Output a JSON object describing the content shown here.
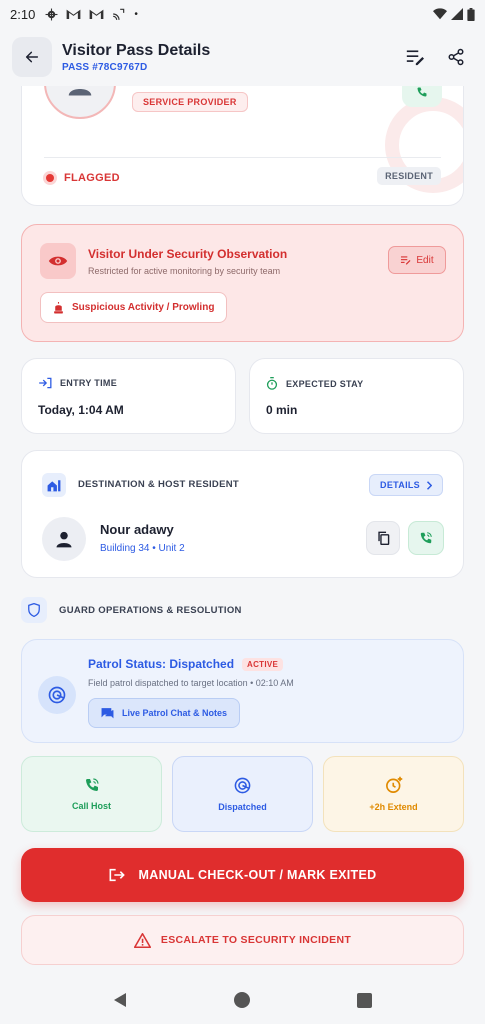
{
  "status_bar": {
    "time": "2:10"
  },
  "app_bar": {
    "title": "Visitor Pass Details",
    "pass_id": "PASS #78C9767D"
  },
  "profile": {
    "role_badge": "SERVICE PROVIDER",
    "flag_label": "FLAGGED",
    "resident_badge": "RESIDENT"
  },
  "observation": {
    "title": "Visitor Under Security Observation",
    "subtitle": "Restricted for active monitoring by security team",
    "edit_label": "Edit",
    "reason": "Suspicious Activity / Prowling"
  },
  "entry": {
    "label": "ENTRY TIME",
    "value": "Today, 1:04 AM"
  },
  "stay": {
    "label": "EXPECTED STAY",
    "value": "0 min"
  },
  "destination": {
    "title": "DESTINATION & HOST RESIDENT",
    "details_label": "DETAILS",
    "host_name": "Nour adawy",
    "host_unit": "Building 34 • Unit 2"
  },
  "guard_ops": {
    "title": "GUARD OPERATIONS & RESOLUTION",
    "patrol_title": "Patrol Status: Dispatched",
    "patrol_badge": "ACTIVE",
    "patrol_sub": "Field patrol dispatched to target location • 02:10 AM",
    "chat_label": "Live Patrol Chat & Notes"
  },
  "quick_actions": {
    "call": "Call Host",
    "dispatched": "Dispatched",
    "extend": "+2h Extend"
  },
  "buttons": {
    "checkout": "MANUAL CHECK-OUT / MARK EXITED",
    "escalate": "ESCALATE TO SECURITY INCIDENT"
  },
  "colors": {
    "accent_blue": "#2d5be3",
    "danger_red": "#e02d2d",
    "success_green": "#1e9e5a",
    "warning_orange": "#e08a00"
  }
}
